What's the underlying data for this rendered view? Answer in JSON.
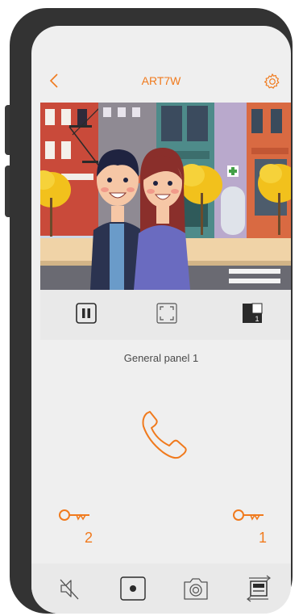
{
  "header": {
    "title": "ART7W",
    "back_icon": "chevron-left-icon",
    "settings_icon": "gear-icon"
  },
  "video": {
    "description_icon": "camera-feed-image"
  },
  "controls": {
    "items": [
      "pause-icon",
      "fullscreen-icon",
      "camera-switch-icon"
    ],
    "camera_badge": "1"
  },
  "panel": {
    "label": "General panel 1"
  },
  "call": {
    "icon": "phone-icon"
  },
  "locks": {
    "left_number": "2",
    "right_number": "1",
    "icon": "key-icon"
  },
  "toolbar": {
    "items": [
      "mute-icon",
      "record-icon",
      "snapshot-icon",
      "panel-switch-icon"
    ]
  },
  "colors": {
    "accent": "#f07a1d",
    "phone_body": "#333333",
    "screen_bg": "#efefef",
    "panel_bg": "#e9e9e9"
  }
}
